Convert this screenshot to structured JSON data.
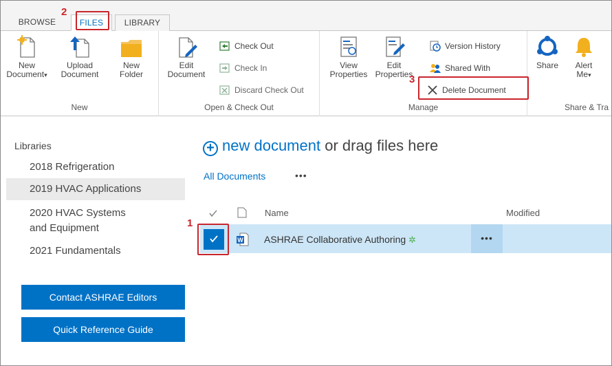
{
  "tabs": [
    "BROWSE",
    "FILES",
    "LIBRARY"
  ],
  "annotations": [
    "1",
    "2",
    "3"
  ],
  "ribbon": {
    "new_group": {
      "label": "New",
      "new_document": "New\nDocument",
      "new_document_caret": "▾",
      "upload_document": "Upload\nDocument",
      "new_folder": "New\nFolder"
    },
    "checkout_group": {
      "label": "Open & Check Out",
      "edit_document": "Edit\nDocument",
      "check_out": "Check Out",
      "check_in": "Check In",
      "discard_check_out": "Discard Check Out"
    },
    "manage_group": {
      "label": "Manage",
      "view_properties": "View\nProperties",
      "edit_properties": "Edit\nProperties",
      "version_history": "Version History",
      "shared_with": "Shared With",
      "delete_document": "Delete Document"
    },
    "share_group": {
      "label": "Share & Tra",
      "share": "Share",
      "alert_me": "Alert\nMe",
      "alert_caret": "▾"
    }
  },
  "leftnav": {
    "heading": "Libraries",
    "items": [
      "2018 Refrigeration",
      "2019 HVAC Applications",
      "2020 HVAC Systems\nand Equipment",
      "2021 Fundamentals"
    ],
    "buttons": [
      "Contact ASHRAE Editors",
      "Quick Reference Guide"
    ]
  },
  "main": {
    "new_document_link": "new document",
    "new_document_suffix": " or drag files here",
    "view_name": "All Documents",
    "view_more": "•••",
    "columns": {
      "name": "Name",
      "modified": "Modified"
    },
    "rows": [
      {
        "name": "ASHRAE Collaborative Authoring",
        "new_marker": "✲",
        "checked": true,
        "more": "•••"
      }
    ]
  },
  "colors": {
    "accent": "#0072c6",
    "annotation": "#c9252c",
    "row_selected": "#cde6f7"
  }
}
